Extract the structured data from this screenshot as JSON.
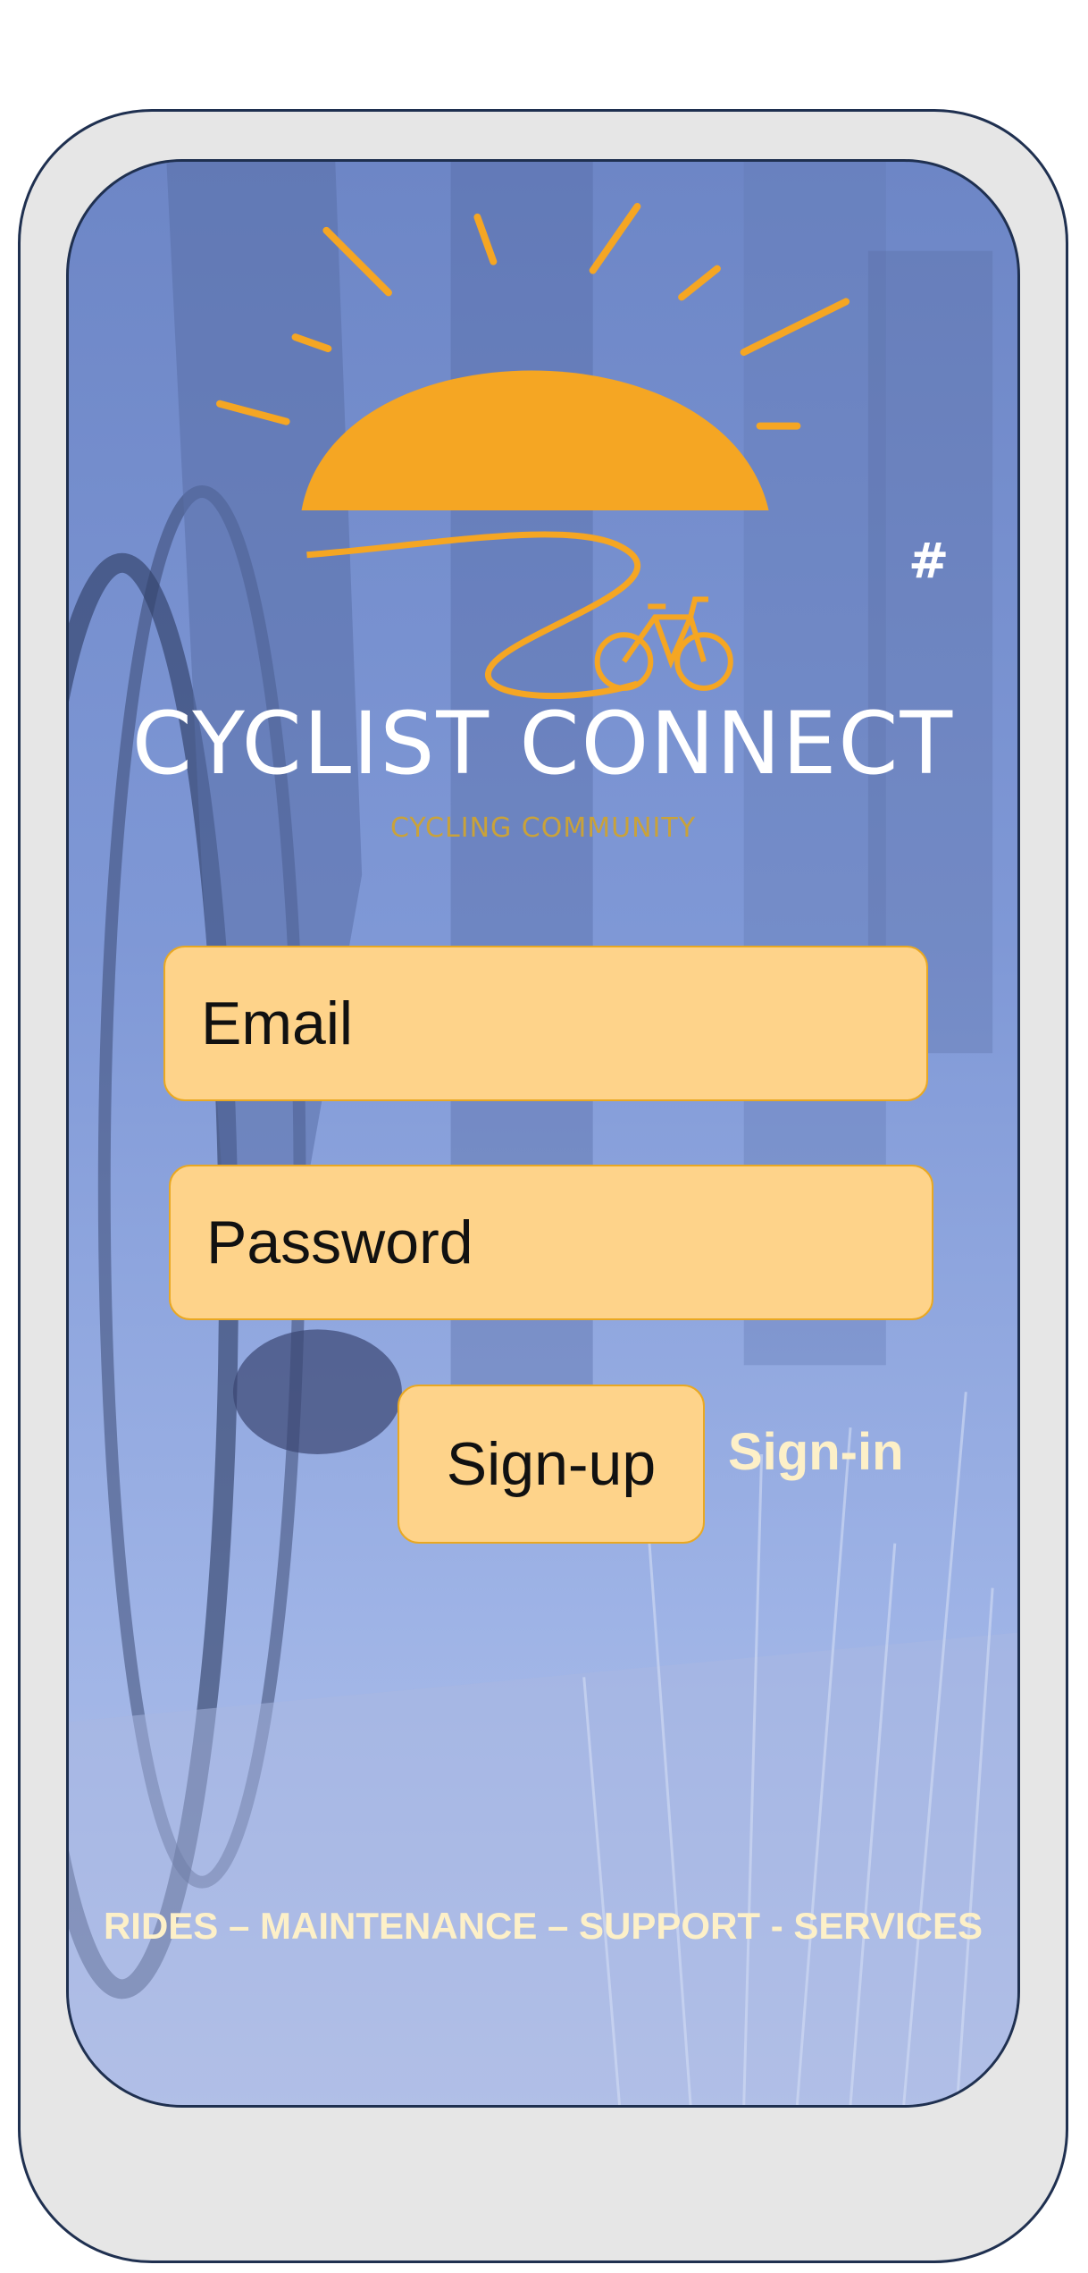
{
  "app": {
    "title": "CYCLIST CONNECT",
    "subtitle": "CYCLING COMMUNITY",
    "menu_symbol": "#"
  },
  "form": {
    "email_label": "Email",
    "password_label": "Password",
    "signup_label": "Sign-up",
    "signin_label": "Sign-in"
  },
  "footer": {
    "tagline": "RIDES – MAINTENANCE – SUPPORT - SERVICES"
  },
  "colors": {
    "accent": "#f5a623",
    "field_fill": "#fed38a",
    "frame": "#1f3050",
    "screen_blue": "#7f98d6"
  },
  "icons": [
    "sun-icon",
    "road-path-icon",
    "bicycle-icon"
  ]
}
